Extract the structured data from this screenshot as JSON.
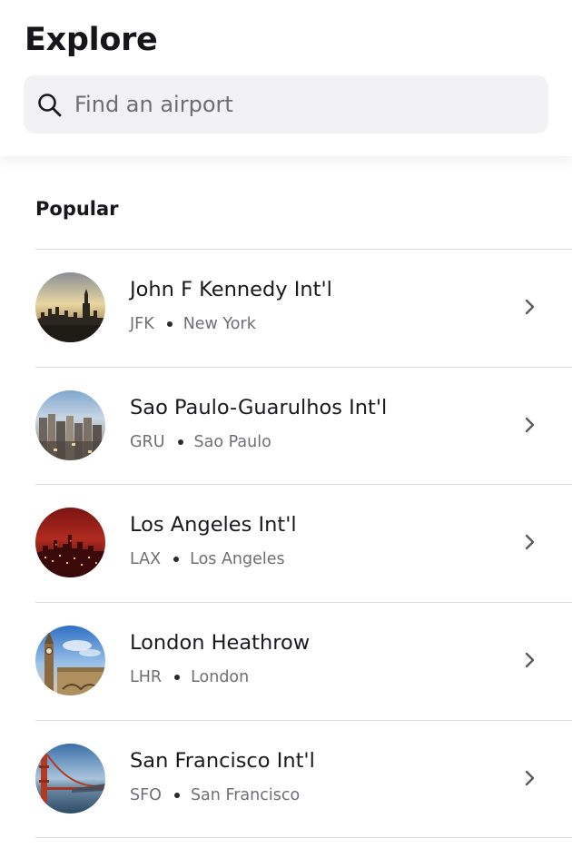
{
  "header": {
    "title": "Explore"
  },
  "search": {
    "placeholder": "Find an airport",
    "value": "",
    "icon": "search-icon"
  },
  "section": {
    "title": "Popular"
  },
  "airports": [
    {
      "name": "John F Kennedy Int'l",
      "code": "JFK",
      "city": "New York",
      "thumbnail": "new-york-skyline"
    },
    {
      "name": "Sao Paulo-Guarulhos Int'l",
      "code": "GRU",
      "city": "Sao Paulo",
      "thumbnail": "sao-paulo-skyline"
    },
    {
      "name": "Los Angeles Int'l",
      "code": "LAX",
      "city": "Los Angeles",
      "thumbnail": "los-angeles-night"
    },
    {
      "name": "London Heathrow",
      "code": "LHR",
      "city": "London",
      "thumbnail": "london-big-ben"
    },
    {
      "name": "San Francisco Int'l",
      "code": "SFO",
      "city": "San Francisco",
      "thumbnail": "golden-gate-bridge"
    }
  ],
  "colors": {
    "background": "#ffffff",
    "search_background": "#f2f2f4",
    "text_primary": "#1a1a1e",
    "text_secondary": "#6e6e75",
    "divider": "#dcdce0",
    "chevron": "#5a5a62"
  },
  "icons": {
    "row_chevron": "chevron-right-icon",
    "separator": "bullet-dot"
  }
}
